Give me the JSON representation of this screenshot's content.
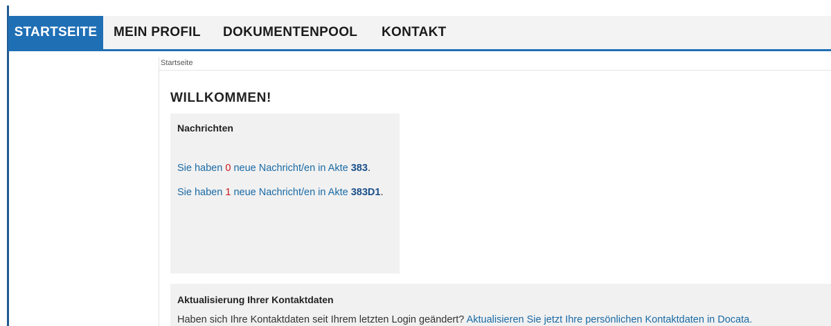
{
  "nav": {
    "items": [
      {
        "label": "STARTSEITE",
        "active": true
      },
      {
        "label": "MEIN PROFIL",
        "active": false
      },
      {
        "label": "DOKUMENTENPOOL",
        "active": false
      },
      {
        "label": "KONTAKT",
        "active": false
      }
    ]
  },
  "breadcrumb": "Startseite",
  "page_title": "WILLKOMMEN!",
  "messages": {
    "title": "Nachrichten",
    "entries": [
      {
        "prefix": "Sie haben ",
        "count": "0",
        "middle": " neue Nachricht/en in Akte ",
        "akte": "383",
        "suffix": "."
      },
      {
        "prefix": "Sie haben ",
        "count": "1",
        "middle": " neue Nachricht/en in Akte ",
        "akte": "383D1",
        "suffix": "."
      }
    ]
  },
  "contact": {
    "title": "Aktualisierung Ihrer Kontaktdaten",
    "text": "Haben sich Ihre Kontaktdaten seit Ihrem letzten Login geändert? ",
    "link": "Aktualisieren Sie jetzt Ihre persönlichen Kontaktdaten in Docata."
  },
  "colors": {
    "accent": "#1f6fb5",
    "link": "#1a6aa5",
    "count_red": "#c8161d",
    "card_bg": "#f1f1f1"
  }
}
